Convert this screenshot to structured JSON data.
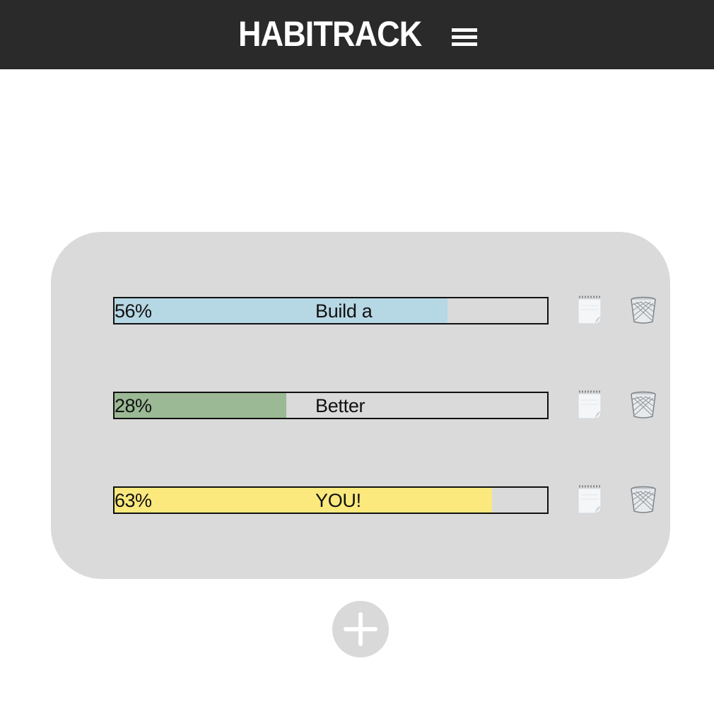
{
  "header": {
    "title": "HABITRACK",
    "menu_icon": "hamburger-menu-icon",
    "background": "#2a2a2a"
  },
  "habits": [
    {
      "percent_label": "56%",
      "progress": 0.77,
      "name": "Build a",
      "color": "#b6d7e4",
      "note_icon": "notepad-icon",
      "delete_icon": "trash-icon"
    },
    {
      "percent_label": "28%",
      "progress": 0.397,
      "name": "Better",
      "color": "#9ab994",
      "note_icon": "notepad-icon",
      "delete_icon": "trash-icon"
    },
    {
      "percent_label": "63%",
      "progress": 0.872,
      "name": "YOU!",
      "color": "#fbe97e",
      "note_icon": "notepad-icon",
      "delete_icon": "trash-icon"
    }
  ],
  "add_button": {
    "icon": "plus-icon"
  },
  "colors": {
    "card": "#dadada",
    "bar_border": "#111111",
    "add_button": "#d9d9d9"
  }
}
